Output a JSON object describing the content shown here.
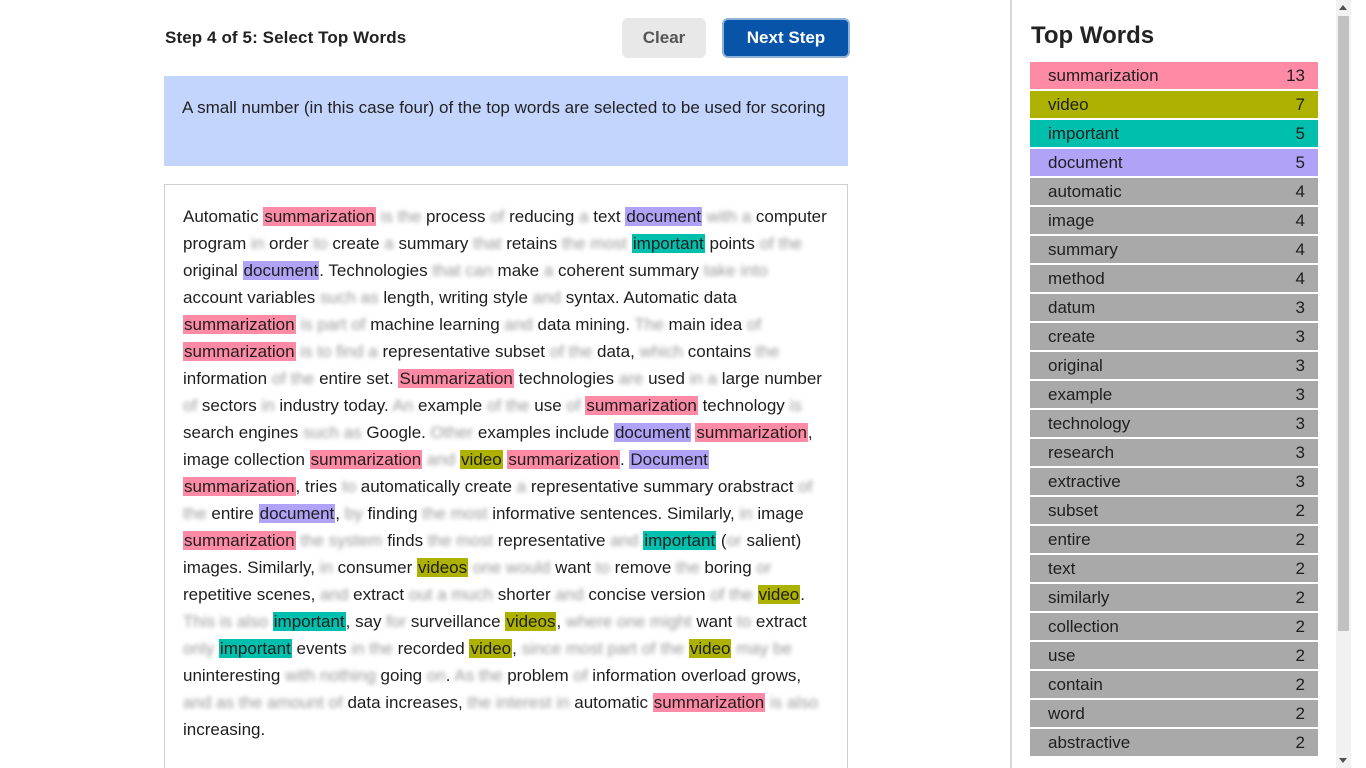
{
  "header": {
    "step_title": "Step 4 of 5: Select Top Words",
    "clear_label": "Clear",
    "next_label": "Next Step"
  },
  "info": {
    "text": "A small number (in this case four) of the top words are selected to be used for scoring"
  },
  "colors": {
    "summarization": "#ff8aa5",
    "video": "#adb200",
    "important": "#00bfac",
    "document": "#b0a3f7",
    "inactive": "#a9a9a9",
    "info_bg": "#c3d5fd",
    "next_button": "#0754a8"
  },
  "document": {
    "paragraphs": [
      [
        {
          "t": "Automatic "
        },
        {
          "t": "summarization",
          "h": "summarization"
        },
        {
          "t": " is the",
          "b": true
        },
        {
          "t": " process "
        },
        {
          "t": "of",
          "b": true
        },
        {
          "t": " reducing "
        },
        {
          "t": "a",
          "b": true
        },
        {
          "t": " text "
        },
        {
          "t": "document",
          "h": "document"
        },
        {
          "t": " with a",
          "b": true
        },
        {
          "t": " computer program "
        },
        {
          "t": "in",
          "b": true
        },
        {
          "t": " order "
        },
        {
          "t": "to",
          "b": true
        },
        {
          "t": " create "
        },
        {
          "t": "a",
          "b": true
        },
        {
          "t": " summary "
        },
        {
          "t": "that",
          "b": true
        },
        {
          "t": " retains "
        },
        {
          "t": "the most",
          "b": true
        },
        {
          "t": " "
        },
        {
          "t": "important",
          "h": "important"
        },
        {
          "t": " points "
        },
        {
          "t": "of the",
          "b": true
        },
        {
          "t": " original "
        },
        {
          "t": "document",
          "h": "document"
        },
        {
          "t": ". Technologies "
        },
        {
          "t": "that can",
          "b": true
        },
        {
          "t": " make "
        },
        {
          "t": "a",
          "b": true
        },
        {
          "t": " coherent summary "
        },
        {
          "t": "take into",
          "b": true
        },
        {
          "t": " account variables "
        },
        {
          "t": "such as",
          "b": true
        },
        {
          "t": " length, writing style "
        },
        {
          "t": "and",
          "b": true
        },
        {
          "t": " syntax. Automatic data "
        },
        {
          "t": "summarization",
          "h": "summarization"
        },
        {
          "t": " is part of",
          "b": true
        },
        {
          "t": " machine learning "
        },
        {
          "t": "and",
          "b": true
        },
        {
          "t": " data mining. "
        },
        {
          "t": "The",
          "b": true
        },
        {
          "t": " main idea "
        },
        {
          "t": "of",
          "b": true
        },
        {
          "t": " "
        },
        {
          "t": "summarization",
          "h": "summarization"
        },
        {
          "t": " is to find a",
          "b": true
        },
        {
          "t": " representative subset "
        },
        {
          "t": "of the",
          "b": true
        },
        {
          "t": " data, "
        },
        {
          "t": "which",
          "b": true
        },
        {
          "t": " contains "
        },
        {
          "t": "the",
          "b": true
        },
        {
          "t": " information "
        },
        {
          "t": "of the",
          "b": true
        },
        {
          "t": " entire set. "
        },
        {
          "t": "Summarization",
          "h": "summarization"
        },
        {
          "t": " technologies "
        },
        {
          "t": "are",
          "b": true
        },
        {
          "t": " used "
        },
        {
          "t": "in a",
          "b": true
        },
        {
          "t": " large number "
        },
        {
          "t": "of",
          "b": true
        },
        {
          "t": " sectors "
        },
        {
          "t": "in",
          "b": true
        },
        {
          "t": " industry today. "
        },
        {
          "t": "An",
          "b": true
        },
        {
          "t": " example "
        },
        {
          "t": "of the",
          "b": true
        },
        {
          "t": " use "
        },
        {
          "t": "of",
          "b": true
        },
        {
          "t": " "
        },
        {
          "t": "summarization",
          "h": "summarization"
        },
        {
          "t": " technology "
        },
        {
          "t": "is",
          "b": true
        },
        {
          "t": " search engines "
        },
        {
          "t": "such as",
          "b": true
        },
        {
          "t": " Google. "
        },
        {
          "t": "Other",
          "b": true
        },
        {
          "t": " examples include "
        },
        {
          "t": "document",
          "h": "document"
        },
        {
          "t": " "
        },
        {
          "t": "summarization",
          "h": "summarization"
        },
        {
          "t": ", image collection "
        },
        {
          "t": "summarization",
          "h": "summarization"
        },
        {
          "t": " "
        },
        {
          "t": "and",
          "b": true
        },
        {
          "t": " "
        },
        {
          "t": "video",
          "h": "video"
        },
        {
          "t": " "
        },
        {
          "t": "summarization",
          "h": "summarization"
        },
        {
          "t": ". "
        },
        {
          "t": "Document",
          "h": "document"
        },
        {
          "t": " "
        },
        {
          "t": "summarization",
          "h": "summarization"
        },
        {
          "t": ", tries "
        },
        {
          "t": "to",
          "b": true
        },
        {
          "t": " automatically create "
        },
        {
          "t": "a",
          "b": true
        },
        {
          "t": " representative summary orabstract "
        },
        {
          "t": "of the",
          "b": true
        },
        {
          "t": " entire "
        },
        {
          "t": "document",
          "h": "document"
        },
        {
          "t": ", "
        },
        {
          "t": "by",
          "b": true
        },
        {
          "t": " finding "
        },
        {
          "t": "the most",
          "b": true
        },
        {
          "t": " informative sentences. Similarly, "
        },
        {
          "t": "in",
          "b": true
        },
        {
          "t": " image "
        },
        {
          "t": "summarization",
          "h": "summarization"
        },
        {
          "t": " the system",
          "b": true
        },
        {
          "t": " finds "
        },
        {
          "t": "the most",
          "b": true
        },
        {
          "t": " representative "
        },
        {
          "t": "and",
          "b": true
        },
        {
          "t": " "
        },
        {
          "t": "important",
          "h": "important"
        },
        {
          "t": " ("
        },
        {
          "t": "or",
          "b": true
        },
        {
          "t": " salient) images. Similarly, "
        },
        {
          "t": "in",
          "b": true
        },
        {
          "t": " consumer "
        },
        {
          "t": "videos",
          "h": "video"
        },
        {
          "t": " one would",
          "b": true
        },
        {
          "t": " want "
        },
        {
          "t": "to",
          "b": true
        },
        {
          "t": " remove "
        },
        {
          "t": "the",
          "b": true
        },
        {
          "t": " boring "
        },
        {
          "t": "or",
          "b": true
        },
        {
          "t": " repetitive scenes, "
        },
        {
          "t": "and",
          "b": true
        },
        {
          "t": " extract "
        },
        {
          "t": "out a much",
          "b": true
        },
        {
          "t": " shorter "
        },
        {
          "t": "and",
          "b": true
        },
        {
          "t": " concise version "
        },
        {
          "t": "of the",
          "b": true
        },
        {
          "t": " "
        },
        {
          "t": "video",
          "h": "video"
        },
        {
          "t": ". "
        },
        {
          "t": "This is also",
          "b": true
        },
        {
          "t": " "
        },
        {
          "t": "important",
          "h": "important"
        },
        {
          "t": ", say "
        },
        {
          "t": "for",
          "b": true
        },
        {
          "t": " surveillance "
        },
        {
          "t": "videos",
          "h": "video"
        },
        {
          "t": ", "
        },
        {
          "t": "where one might",
          "b": true
        },
        {
          "t": " want "
        },
        {
          "t": "to",
          "b": true
        },
        {
          "t": " extract "
        },
        {
          "t": "only",
          "b": true
        },
        {
          "t": " "
        },
        {
          "t": "important",
          "h": "important"
        },
        {
          "t": " events "
        },
        {
          "t": "in the",
          "b": true
        },
        {
          "t": " recorded "
        },
        {
          "t": "video",
          "h": "video"
        },
        {
          "t": ", "
        },
        {
          "t": "since most part of the",
          "b": true
        },
        {
          "t": " "
        },
        {
          "t": "video",
          "h": "video"
        },
        {
          "t": " may be",
          "b": true
        },
        {
          "t": " uninteresting "
        },
        {
          "t": "with nothing",
          "b": true
        },
        {
          "t": " going "
        },
        {
          "t": "on",
          "b": true
        },
        {
          "t": ". "
        },
        {
          "t": "As the",
          "b": true
        },
        {
          "t": " problem "
        },
        {
          "t": "of",
          "b": true
        },
        {
          "t": " information overload grows, "
        },
        {
          "t": "and as the amount of",
          "b": true
        },
        {
          "t": " data increases, "
        },
        {
          "t": "the interest in",
          "b": true
        },
        {
          "t": " automatic "
        },
        {
          "t": "summarization",
          "h": "summarization"
        },
        {
          "t": " is also",
          "b": true
        },
        {
          "t": " increasing."
        }
      ]
    ]
  },
  "sidebar": {
    "title": "Top Words",
    "words": [
      {
        "word": "summarization",
        "count": "13",
        "color": "#ff8aa5"
      },
      {
        "word": "video",
        "count": "7",
        "color": "#adb200"
      },
      {
        "word": "important",
        "count": "5",
        "color": "#00bfac"
      },
      {
        "word": "document",
        "count": "5",
        "color": "#b0a3f7"
      },
      {
        "word": "automatic",
        "count": "4"
      },
      {
        "word": "image",
        "count": "4"
      },
      {
        "word": "summary",
        "count": "4"
      },
      {
        "word": "method",
        "count": "4"
      },
      {
        "word": "datum",
        "count": "3"
      },
      {
        "word": "create",
        "count": "3"
      },
      {
        "word": "original",
        "count": "3"
      },
      {
        "word": "example",
        "count": "3"
      },
      {
        "word": "technology",
        "count": "3"
      },
      {
        "word": "research",
        "count": "3"
      },
      {
        "word": "extractive",
        "count": "3"
      },
      {
        "word": "subset",
        "count": "2"
      },
      {
        "word": "entire",
        "count": "2"
      },
      {
        "word": "text",
        "count": "2"
      },
      {
        "word": "similarly",
        "count": "2"
      },
      {
        "word": "collection",
        "count": "2"
      },
      {
        "word": "use",
        "count": "2"
      },
      {
        "word": "contain",
        "count": "2"
      },
      {
        "word": "word",
        "count": "2"
      },
      {
        "word": "abstractive",
        "count": "2"
      }
    ]
  }
}
